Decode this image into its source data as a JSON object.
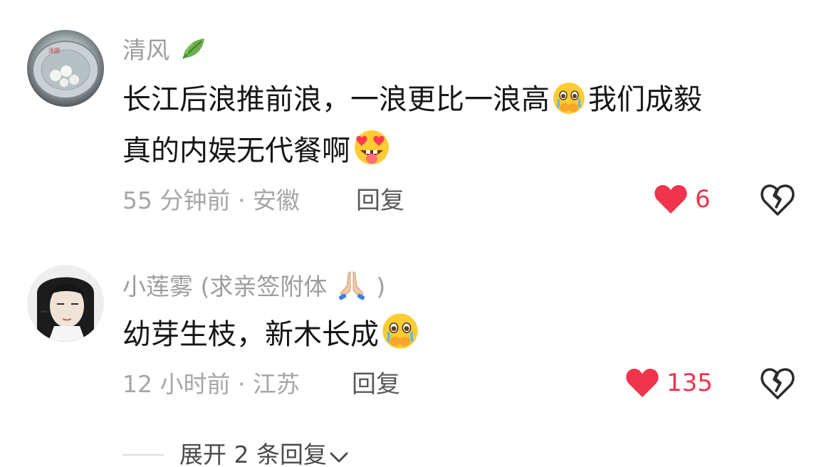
{
  "comments": [
    {
      "username": "清风",
      "username_icon": "leaf-icon",
      "content_part1": "长江后浪推前浪，一浪更比一浪高",
      "emoji1": "crying-face-hands-icon",
      "content_part2": "我们成毅",
      "content_line2": "真的内娱无代餐啊",
      "emoji2": "heart-eyes-tongue-icon",
      "time_location": "55 分钟前 · 安徽",
      "reply_label": "回复",
      "like_count": "6"
    },
    {
      "username": "小莲雾 (求亲签附体",
      "username_icon": "praying-hands-icon",
      "username_suffix": ")",
      "content": "幼芽生枝，新木长成",
      "emoji1": "crying-face-hands-icon",
      "time_location": "12 小时前 · 江苏",
      "reply_label": "回复",
      "like_count": "135"
    }
  ],
  "expand_replies_label": "展开 2 条回复",
  "colors": {
    "like_red": "#f0344d",
    "meta_gray": "#a6a6a6",
    "text": "#161616"
  }
}
